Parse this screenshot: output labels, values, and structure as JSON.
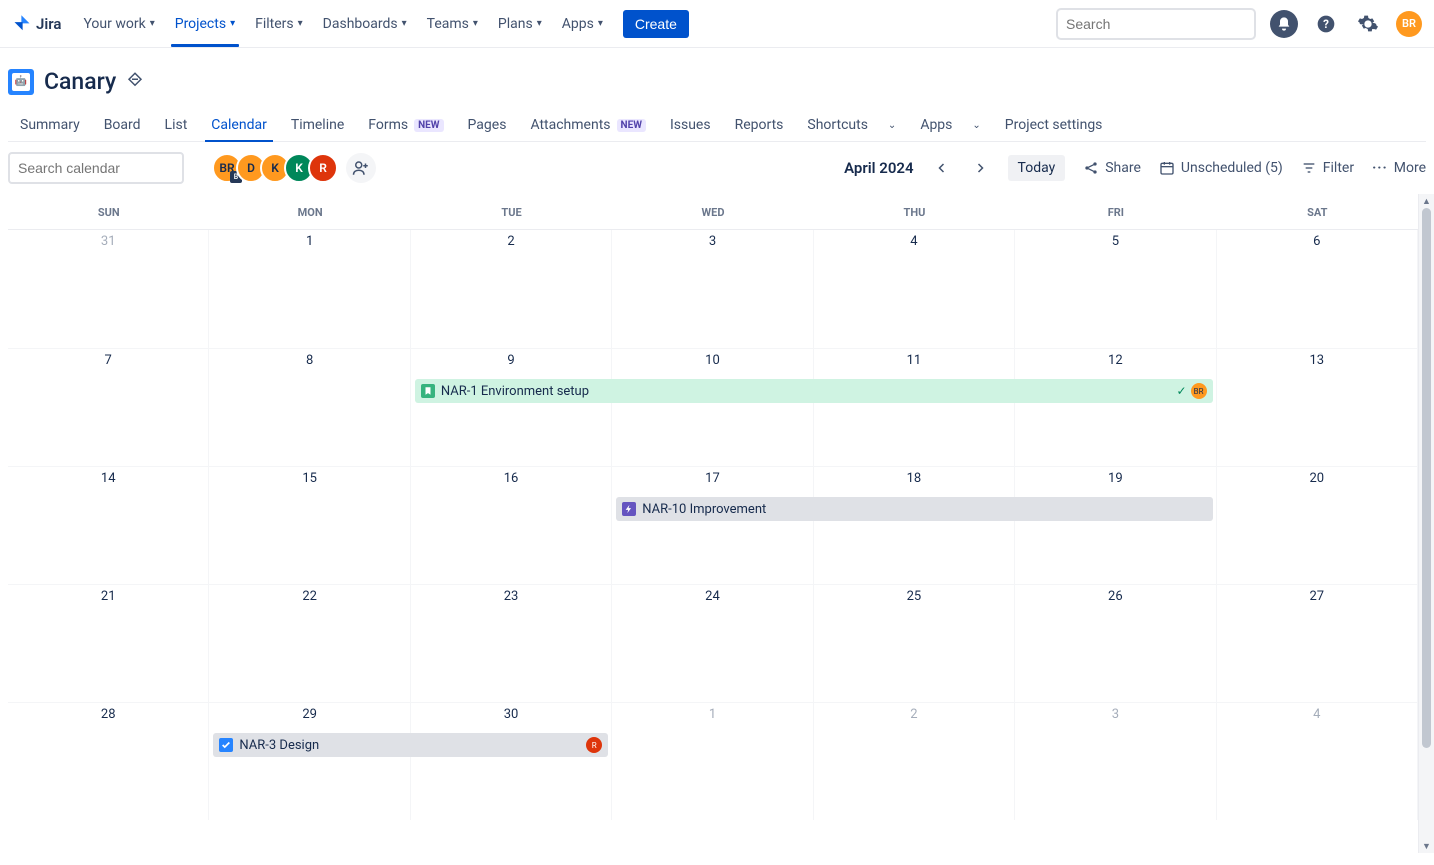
{
  "topnav": {
    "logo_text": "Jira",
    "items": [
      {
        "label": "Your work",
        "active": false
      },
      {
        "label": "Projects",
        "active": true
      },
      {
        "label": "Filters",
        "active": false
      },
      {
        "label": "Dashboards",
        "active": false
      },
      {
        "label": "Teams",
        "active": false
      },
      {
        "label": "Plans",
        "active": false
      },
      {
        "label": "Apps",
        "active": false
      }
    ],
    "create_label": "Create",
    "search_placeholder": "Search",
    "avatar_initials": "BR"
  },
  "project": {
    "name": "Canary",
    "tabs": [
      {
        "label": "Summary",
        "badge": null,
        "chev": false
      },
      {
        "label": "Board",
        "badge": null,
        "chev": false
      },
      {
        "label": "List",
        "badge": null,
        "chev": false
      },
      {
        "label": "Calendar",
        "badge": null,
        "chev": false,
        "active": true
      },
      {
        "label": "Timeline",
        "badge": null,
        "chev": false
      },
      {
        "label": "Forms",
        "badge": "NEW",
        "chev": false
      },
      {
        "label": "Pages",
        "badge": null,
        "chev": false
      },
      {
        "label": "Attachments",
        "badge": "NEW",
        "chev": false
      },
      {
        "label": "Issues",
        "badge": null,
        "chev": false
      },
      {
        "label": "Reports",
        "badge": null,
        "chev": false
      },
      {
        "label": "Shortcuts",
        "badge": null,
        "chev": true
      },
      {
        "label": "Apps",
        "badge": null,
        "chev": true
      },
      {
        "label": "Project settings",
        "badge": null,
        "chev": false
      }
    ]
  },
  "toolbar": {
    "search_placeholder": "Search calendar",
    "assignees": [
      {
        "initials": "BR",
        "cls": "br",
        "sub": "B"
      },
      {
        "initials": "D",
        "cls": "d"
      },
      {
        "initials": "K",
        "cls": "k1"
      },
      {
        "initials": "K",
        "cls": "k2"
      },
      {
        "initials": "R",
        "cls": "r"
      }
    ],
    "month": "April 2024",
    "today_label": "Today",
    "share_label": "Share",
    "unscheduled_label": "Unscheduled (5)",
    "filter_label": "Filter",
    "more_label": "More"
  },
  "calendar": {
    "weekdays": [
      "SUN",
      "MON",
      "TUE",
      "WED",
      "THU",
      "FRI",
      "SAT"
    ],
    "weeks": [
      {
        "days": [
          {
            "n": "31",
            "dim": true
          },
          {
            "n": "1"
          },
          {
            "n": "2"
          },
          {
            "n": "3"
          },
          {
            "n": "4"
          },
          {
            "n": "5"
          },
          {
            "n": "6"
          }
        ]
      },
      {
        "days": [
          {
            "n": "7"
          },
          {
            "n": "8"
          },
          {
            "n": "9"
          },
          {
            "n": "10"
          },
          {
            "n": "11"
          },
          {
            "n": "12"
          },
          {
            "n": "13"
          }
        ],
        "events": [
          {
            "start": 2,
            "span": 4,
            "title": "NAR-1 Environment setup",
            "color": "#CFF3E2",
            "icon_bg": "#36B37E",
            "icon": "bookmark",
            "extras": "done_br"
          }
        ]
      },
      {
        "days": [
          {
            "n": "14"
          },
          {
            "n": "15"
          },
          {
            "n": "16"
          },
          {
            "n": "17"
          },
          {
            "n": "18"
          },
          {
            "n": "19"
          },
          {
            "n": "20"
          }
        ],
        "events": [
          {
            "start": 3,
            "span": 3,
            "title": "NAR-10 Improvement",
            "color": "#DFE1E6",
            "icon_bg": "#6554C0",
            "icon": "bolt"
          }
        ]
      },
      {
        "days": [
          {
            "n": "21"
          },
          {
            "n": "22"
          },
          {
            "n": "23"
          },
          {
            "n": "24"
          },
          {
            "n": "25"
          },
          {
            "n": "26"
          },
          {
            "n": "27"
          }
        ]
      },
      {
        "days": [
          {
            "n": "28"
          },
          {
            "n": "29"
          },
          {
            "n": "30"
          },
          {
            "n": "1",
            "dim": true
          },
          {
            "n": "2",
            "dim": true
          },
          {
            "n": "3",
            "dim": true
          },
          {
            "n": "4",
            "dim": true
          }
        ],
        "events": [
          {
            "start": 1,
            "span": 2,
            "title": "NAR-3 Design",
            "color": "#DFE1E6",
            "icon_bg": "#2684FF",
            "icon": "check",
            "extras": "r_avatar"
          }
        ]
      }
    ]
  }
}
